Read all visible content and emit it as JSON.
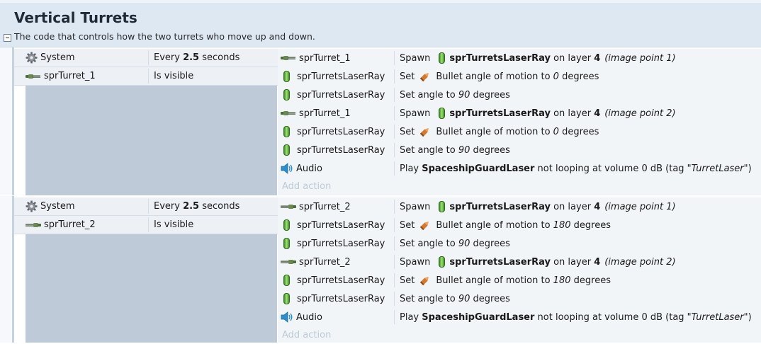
{
  "group": {
    "title": "Vertical Turrets",
    "description": "The code that controls how the two turrets who move up and down."
  },
  "events": [
    {
      "conditions": [
        {
          "object": "System",
          "icon": "gear-icon",
          "pre": "Every ",
          "value": "2.5",
          "post": " seconds"
        },
        {
          "object": "sprTurret_1",
          "icon": "turret-icon",
          "text": "Is visible"
        }
      ],
      "actions": [
        {
          "object": "sprTurret_1",
          "icon": "turret-icon",
          "kind": "spawn",
          "verb": "Spawn",
          "target": "sprTurretsLaserRay",
          "layer_pre": " on layer ",
          "layer": "4",
          "point": "(image point 1)"
        },
        {
          "object": "sprTurretsLaserRay",
          "icon": "laser-icon",
          "kind": "bullet",
          "verb": "Set",
          "text_pre": "Bullet angle of motion to ",
          "value": "0",
          "text_post": " degrees"
        },
        {
          "object": "sprTurretsLaserRay",
          "icon": "laser-icon",
          "kind": "angle",
          "text_pre": "Set angle to ",
          "value": "90",
          "text_post": " degrees"
        },
        {
          "object": "sprTurret_1",
          "icon": "turret-icon",
          "kind": "spawn",
          "verb": "Spawn",
          "target": "sprTurretsLaserRay",
          "layer_pre": " on layer ",
          "layer": "4",
          "point": "(image point 2)"
        },
        {
          "object": "sprTurretsLaserRay",
          "icon": "laser-icon",
          "kind": "bullet",
          "verb": "Set",
          "text_pre": "Bullet angle of motion to ",
          "value": "0",
          "text_post": " degrees"
        },
        {
          "object": "sprTurretsLaserRay",
          "icon": "laser-icon",
          "kind": "angle",
          "text_pre": "Set angle to ",
          "value": "90",
          "text_post": " degrees"
        },
        {
          "object": "Audio",
          "icon": "speaker-icon",
          "kind": "audio",
          "pre": "Play ",
          "sound": "SpaceshipGuardLaser",
          "mid": " not looping at volume 0 dB (tag \"",
          "tag": "TurretLaser",
          "post": "\")"
        }
      ],
      "add_action": "Add action"
    },
    {
      "conditions": [
        {
          "object": "System",
          "icon": "gear-icon",
          "pre": "Every ",
          "value": "2.5",
          "post": " seconds"
        },
        {
          "object": "sprTurret_2",
          "icon": "turret-icon",
          "text": "Is visible"
        }
      ],
      "actions": [
        {
          "object": "sprTurret_2",
          "icon": "turret-icon",
          "kind": "spawn",
          "verb": "Spawn",
          "target": "sprTurretsLaserRay",
          "layer_pre": " on layer ",
          "layer": "4",
          "point": "(image point 1)"
        },
        {
          "object": "sprTurretsLaserRay",
          "icon": "laser-icon",
          "kind": "bullet",
          "verb": "Set",
          "text_pre": "Bullet angle of motion to ",
          "value": "180",
          "text_post": " degrees"
        },
        {
          "object": "sprTurretsLaserRay",
          "icon": "laser-icon",
          "kind": "angle",
          "text_pre": "Set angle to ",
          "value": "90",
          "text_post": " degrees"
        },
        {
          "object": "sprTurret_2",
          "icon": "turret-icon",
          "kind": "spawn",
          "verb": "Spawn",
          "target": "sprTurretsLaserRay",
          "layer_pre": " on layer ",
          "layer": "4",
          "point": "(image point 2)"
        },
        {
          "object": "sprTurretsLaserRay",
          "icon": "laser-icon",
          "kind": "bullet",
          "verb": "Set",
          "text_pre": "Bullet angle of motion to ",
          "value": "180",
          "text_post": " degrees"
        },
        {
          "object": "sprTurretsLaserRay",
          "icon": "laser-icon",
          "kind": "angle",
          "text_pre": "Set angle to ",
          "value": "90",
          "text_post": " degrees"
        },
        {
          "object": "Audio",
          "icon": "speaker-icon",
          "kind": "audio",
          "pre": "Play ",
          "sound": "SpaceshipGuardLaser",
          "mid": " not looping at volume 0 dB (tag \"",
          "tag": "TurretLaser",
          "post": "\")"
        }
      ],
      "add_action": "Add action"
    }
  ],
  "colors": {
    "header_bg": "#dde8f3",
    "condition_bg": "#edf1f6",
    "condition_fill": "#bfcad9",
    "action_bg": "#f2f5f8",
    "add_action_text": "#bccad8"
  }
}
